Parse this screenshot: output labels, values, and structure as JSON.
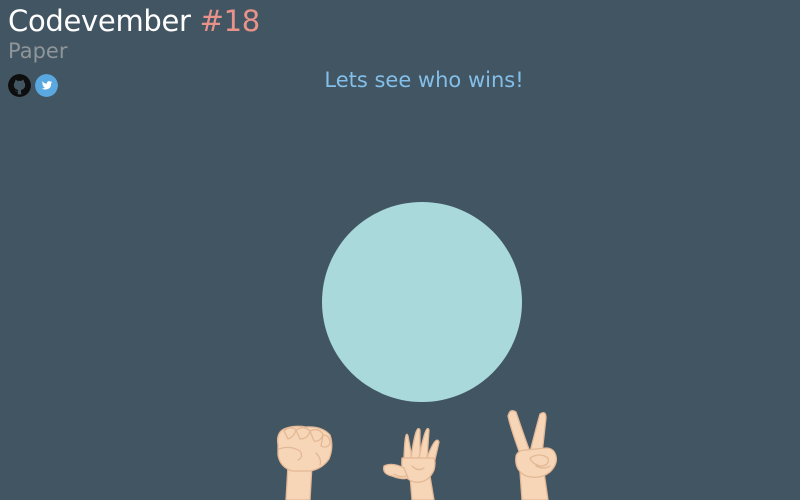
{
  "header": {
    "title": "Codevember",
    "number": "#18",
    "subtitle": "Paper"
  },
  "social": [
    {
      "icon": "github-icon"
    },
    {
      "icon": "twitter-icon"
    }
  ],
  "game": {
    "prompt": "Lets see who wins!",
    "choices": [
      "rock",
      "paper",
      "scissors"
    ]
  },
  "colors": {
    "background": "#425563",
    "title": "#ffffff",
    "accent": "#e8928a",
    "subtitle": "#8f9599",
    "prompt": "#83bfe8",
    "circle": "#a9d9da",
    "skin": "#f6d6b6",
    "skin_shade": "#e3b896",
    "twitter": "#5aa8e0"
  }
}
